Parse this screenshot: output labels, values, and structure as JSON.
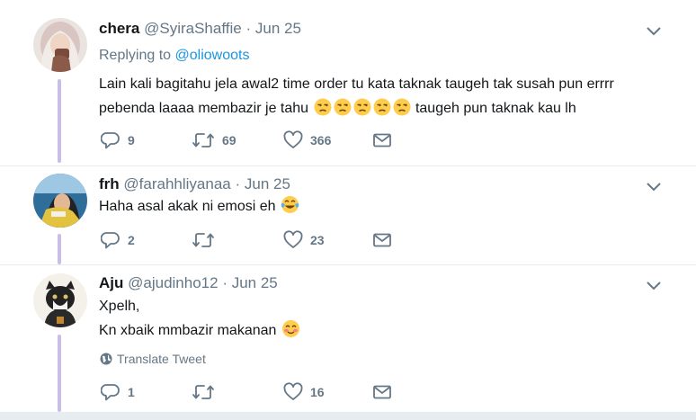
{
  "tweets": [
    {
      "name": "chera",
      "handle": "@SyiraShaffie",
      "dot": "·",
      "date": "Jun 25",
      "replying_prefix": "Replying to",
      "replying_handle": "@oliowoots",
      "line1": "Lain kali bagitahu jela awal2 time order tu kata taknak taugeh tak susah pun errrr",
      "line2_start": "pebenda laaaa membazir je tahu",
      "line2_end": "taugeh pun taknak kau lh",
      "emojis": [
        "unamused-face",
        "unamused-face",
        "unamused-face",
        "unamused-face",
        "unamused-face"
      ],
      "replies": "9",
      "retweets": "69",
      "likes": "366"
    },
    {
      "name": "frh",
      "handle": "@farahhliyanaa",
      "dot": "·",
      "date": "Jun 25",
      "line1": "Haha asal akak ni emosi eh",
      "emojis": [
        "face-with-tears-of-joy"
      ],
      "replies": "2",
      "retweets": "",
      "likes": "23"
    },
    {
      "name": "Aju",
      "handle": "@ajudinho12",
      "dot": "·",
      "date": "Jun 25",
      "line1": "Xpelh,",
      "line2": "Kn xbaik mmbazir makanan",
      "emojis": [
        "smiling-face"
      ],
      "translate_label": "Translate Tweet",
      "replies": "1",
      "retweets": "",
      "likes": "16"
    }
  ],
  "colors": {
    "accent": "#1b95e0",
    "secondary_text": "#657786",
    "thread_line": "#c9bfe6",
    "divider": "#e6ecf0"
  }
}
